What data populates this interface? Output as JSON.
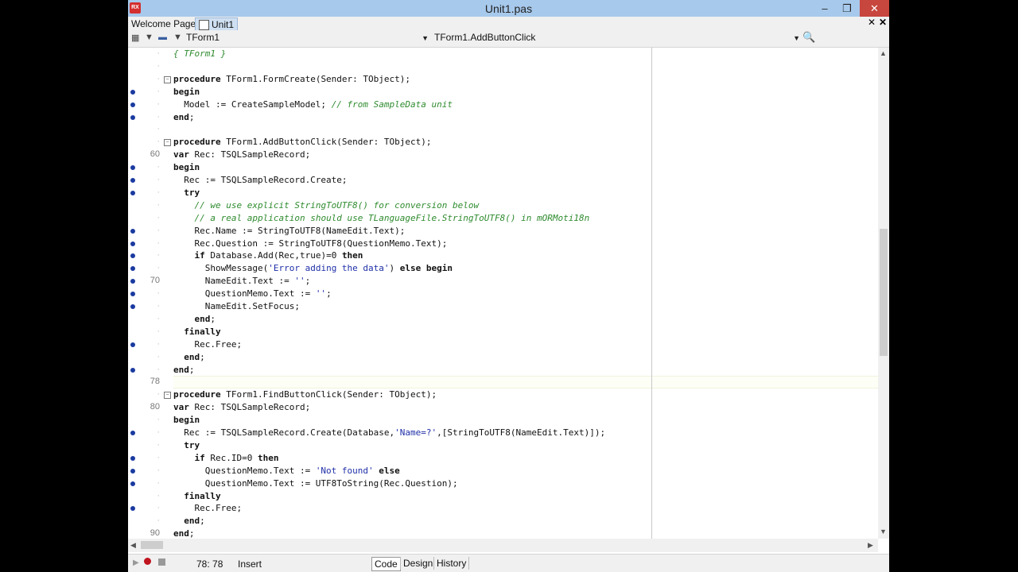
{
  "window": {
    "title": "Unit1.pas",
    "app_icon_label": "RX",
    "minimize": "–",
    "maximize": "❐",
    "close": "✕"
  },
  "tabs": [
    {
      "label": "Welcome Page"
    },
    {
      "label": "Unit1",
      "active": true
    }
  ],
  "toolbar": {
    "class_combo": "TForm1",
    "method_combo": "TForm1.AddButtonClick"
  },
  "editor": {
    "lines": [
      {
        "text": "{ TForm1 }",
        "cls": "cm",
        "num": "",
        "dot": false,
        "fold": ""
      },
      {
        "text": "",
        "num": "",
        "dot": false,
        "fold": ""
      },
      {
        "html": "<span class='kw'>procedure</span> TForm1.FormCreate(Sender: TObject);",
        "num": "",
        "dot": false,
        "fold": "box"
      },
      {
        "html": "<span class='kw'>begin</span>",
        "num": "",
        "dot": true,
        "fold": ""
      },
      {
        "html": "  Model := CreateSampleModel; <span class='cm'>// from SampleData unit</span>",
        "num": "",
        "dot": true,
        "fold": ""
      },
      {
        "html": "<span class='kw'>end</span>;",
        "num": "",
        "dot": true,
        "fold": ""
      },
      {
        "text": "",
        "num": "",
        "dot": false,
        "fold": ""
      },
      {
        "html": "<span class='kw'>procedure</span> TForm1.AddButtonClick(Sender: TObject);",
        "num": "",
        "dot": false,
        "fold": "box"
      },
      {
        "html": "<span class='kw'>var</span> Rec: TSQLSampleRecord;",
        "num": "60",
        "dot": false,
        "fold": ""
      },
      {
        "html": "<span class='kw'>begin</span>",
        "num": "",
        "dot": true,
        "fold": ""
      },
      {
        "html": "  Rec := TSQLSampleRecord.Create;",
        "num": "",
        "dot": true,
        "fold": ""
      },
      {
        "html": "  <span class='kw'>try</span>",
        "num": "",
        "dot": true,
        "fold": ""
      },
      {
        "html": "    <span class='cm'>// we use explicit StringToUTF8() for conversion below</span>",
        "num": "",
        "dot": false,
        "fold": ""
      },
      {
        "html": "    <span class='cm'>// a real application should use TLanguageFile.StringToUTF8() in mORMoti18n</span>",
        "num": "",
        "dot": false,
        "fold": ""
      },
      {
        "html": "    Rec.Name := StringToUTF8(NameEdit.Text);",
        "num": "",
        "dot": true,
        "fold": ""
      },
      {
        "html": "    Rec.Question := StringToUTF8(QuestionMemo.Text);",
        "num": "",
        "dot": true,
        "fold": ""
      },
      {
        "html": "    <span class='kw'>if</span> Database.Add(Rec,true)=0 <span class='kw'>then</span>",
        "num": "",
        "dot": true,
        "fold": ""
      },
      {
        "html": "      ShowMessage(<span class='st'>'Error adding the data'</span>) <span class='kw'>else</span> <span class='kw'>begin</span>",
        "num": "",
        "dot": true,
        "fold": ""
      },
      {
        "html": "      NameEdit.Text := <span class='st'>''</span>;",
        "num": "70",
        "dot": true,
        "fold": ""
      },
      {
        "html": "      QuestionMemo.Text := <span class='st'>''</span>;",
        "num": "",
        "dot": true,
        "fold": ""
      },
      {
        "html": "      NameEdit.SetFocus;",
        "num": "",
        "dot": true,
        "fold": ""
      },
      {
        "html": "    <span class='kw'>end</span>;",
        "num": "",
        "dot": false,
        "fold": ""
      },
      {
        "html": "  <span class='kw'>finally</span>",
        "num": "",
        "dot": false,
        "fold": ""
      },
      {
        "html": "    Rec.Free;",
        "num": "",
        "dot": true,
        "fold": ""
      },
      {
        "html": "  <span class='kw'>end</span>;",
        "num": "",
        "dot": false,
        "fold": ""
      },
      {
        "html": "<span class='kw'>end</span>;",
        "num": "",
        "dot": true,
        "fold": ""
      },
      {
        "text": "",
        "num": "78",
        "dot": false,
        "fold": ""
      },
      {
        "html": "<span class='kw'>procedure</span> TForm1.FindButtonClick(Sender: TObject);",
        "num": "",
        "dot": false,
        "fold": "box"
      },
      {
        "html": "<span class='kw'>var</span> Rec: TSQLSampleRecord;",
        "num": "80",
        "dot": false,
        "fold": ""
      },
      {
        "html": "<span class='kw'>begin</span>",
        "num": "",
        "dot": false,
        "fold": ""
      },
      {
        "html": "  Rec := TSQLSampleRecord.Create(Database,<span class='st'>'Name=?'</span>,[StringToUTF8(NameEdit.Text)]);",
        "num": "",
        "dot": true,
        "fold": ""
      },
      {
        "html": "  <span class='kw'>try</span>",
        "num": "",
        "dot": false,
        "fold": ""
      },
      {
        "html": "    <span class='kw'>if</span> Rec.ID=0 <span class='kw'>then</span>",
        "num": "",
        "dot": true,
        "fold": ""
      },
      {
        "html": "      QuestionMemo.Text := <span class='st'>'Not found'</span> <span class='kw'>else</span>",
        "num": "",
        "dot": true,
        "fold": ""
      },
      {
        "html": "      QuestionMemo.Text := UTF8ToString(Rec.Question);",
        "num": "",
        "dot": true,
        "fold": ""
      },
      {
        "html": "  <span class='kw'>finally</span>",
        "num": "",
        "dot": false,
        "fold": ""
      },
      {
        "html": "    Rec.Free;",
        "num": "",
        "dot": true,
        "fold": ""
      },
      {
        "html": "  <span class='kw'>end</span>;",
        "num": "",
        "dot": false,
        "fold": ""
      },
      {
        "html": "<span class='kw'>end</span>;",
        "num": "90",
        "dot": false,
        "fold": ""
      }
    ]
  },
  "status": {
    "position": "78:  78",
    "mode": "Insert",
    "tabs": [
      "Code",
      "Design",
      "History"
    ]
  }
}
